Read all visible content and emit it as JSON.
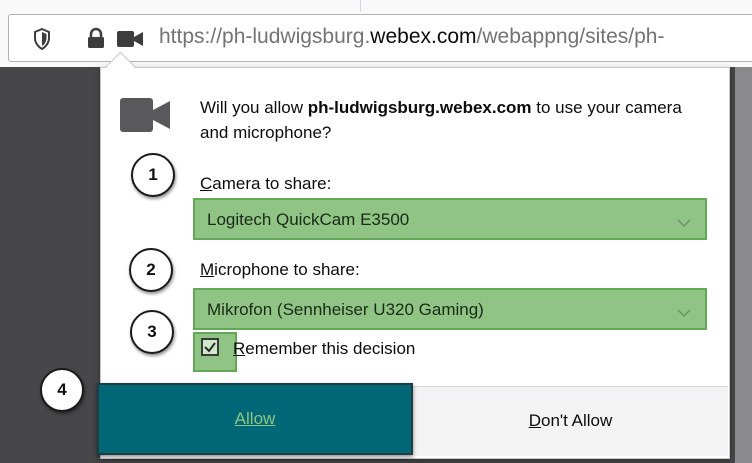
{
  "browser": {
    "url_prefix": "https://ph-ludwigsburg.",
    "url_host": "webex.com",
    "url_suffix": "/webappng/sites/ph-"
  },
  "permission_dialog": {
    "question_prefix": "Will you allow ",
    "question_site": "ph-ludwigsburg.webex.com",
    "question_suffix": " to use your camera and microphone?",
    "camera_label_key": "C",
    "camera_label_rest": "amera to share:",
    "camera_selected": "Logitech QuickCam E3500",
    "microphone_label_key": "M",
    "microphone_label_rest": "icrophone to share:",
    "microphone_selected": "Mikrofon (Sennheiser U320 Gaming)",
    "remember_label_key": "R",
    "remember_label_rest": "emember this decision",
    "remember_checked": true,
    "allow_key": "A",
    "allow_rest": "llow",
    "deny_key": "D",
    "deny_rest": "on't Allow"
  },
  "annotations": [
    "1",
    "2",
    "3",
    "4"
  ],
  "colors": {
    "highlight_green": "#8fc484",
    "allow_button": "#006777",
    "backdrop": "#474749"
  }
}
